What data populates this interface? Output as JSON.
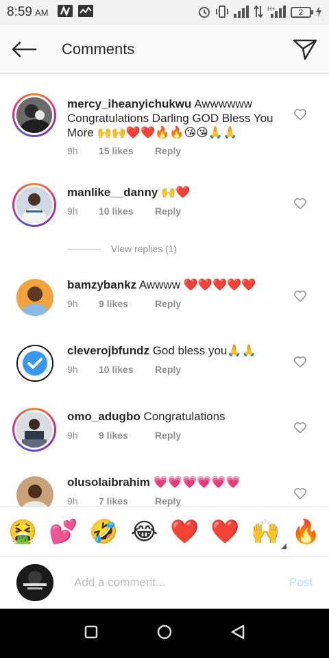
{
  "status_bar": {
    "time": "8:59",
    "ampm": "AM",
    "battery": "2"
  },
  "header": {
    "title": "Comments"
  },
  "comments": [
    {
      "username": "mercy_iheanyichukwu",
      "text": "Awwwwww Congratulations Darling GOD Bless You More 🙌🙌❤️❤️🔥🔥😘😘🙏🙏",
      "time": "9h",
      "likes": "15 likes",
      "reply": "Reply"
    },
    {
      "username": "manlike__danny",
      "text": "🙌❤️",
      "time": "9h",
      "likes": "10 likes",
      "reply": "Reply"
    },
    {
      "username": "bamzybankz",
      "text": "Awwww ❤️❤️❤️❤️❤️",
      "time": "9h",
      "likes": "9 likes",
      "reply": "Reply"
    },
    {
      "username": "cleverojbfundz",
      "text": "God bless you🙏🙏",
      "time": "9h",
      "likes": "10 likes",
      "reply": "Reply"
    },
    {
      "username": "omo_adugbo",
      "text": "Congratulations",
      "time": "9h",
      "likes": "9 likes",
      "reply": "Reply"
    },
    {
      "username": "olusolaibrahim",
      "text": "💗💗💗💗💗💗",
      "time": "9h",
      "likes": "7 likes",
      "reply": "Reply"
    }
  ],
  "view_replies": "View replies (1)",
  "emoji_bar": [
    "🤮",
    "💕",
    "🤣",
    "😂",
    "❤️",
    "❤️",
    "🙌",
    "🔥"
  ],
  "add_comment": {
    "placeholder": "Add a comment...",
    "post_label": "Post"
  },
  "colors": {
    "accent": "#3897f0",
    "post_disabled": "#b3dbff",
    "muted": "#8e8e8e"
  }
}
